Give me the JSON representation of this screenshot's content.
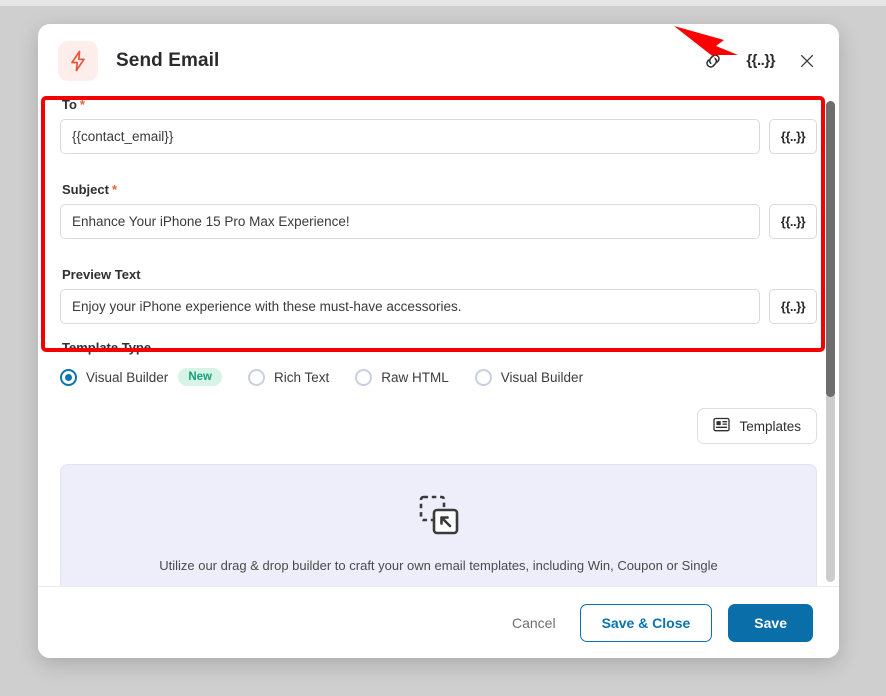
{
  "dialog": {
    "title": "Send Email",
    "icon": "lightning-bolt-icon",
    "header_icons": {
      "link": "link-icon",
      "merge_tag": "{{..}}",
      "close": "close-icon"
    }
  },
  "form": {
    "fields": [
      {
        "label": "To",
        "required": true,
        "required_marker": "*",
        "value": "{{contact_email}}",
        "merge_button_label": "{{..}}"
      },
      {
        "label": "Subject",
        "required": true,
        "required_marker": "*",
        "value": "Enhance Your iPhone 15 Pro Max Experience!",
        "merge_button_label": "{{..}}"
      },
      {
        "label": "Preview Text",
        "required": false,
        "required_marker": "",
        "value": "Enjoy your iPhone experience with these must-have accessories.",
        "merge_button_label": "{{..}}"
      }
    ]
  },
  "template_type": {
    "label": "Template Type",
    "options": [
      {
        "label": "Visual Builder",
        "selected": true,
        "badge": "New"
      },
      {
        "label": "Rich Text",
        "selected": false,
        "badge": ""
      },
      {
        "label": "Raw HTML",
        "selected": false,
        "badge": ""
      },
      {
        "label": "Visual Builder",
        "selected": false,
        "badge": ""
      }
    ]
  },
  "templates_button": {
    "label": "Templates",
    "icon": "templates-icon"
  },
  "builder_placeholder": {
    "icon": "drag-drop-builder-icon",
    "caption": "Utilize our drag & drop builder to craft your own email templates, including Win, Coupon or Single"
  },
  "footer": {
    "cancel_label": "Cancel",
    "save_close_label": "Save & Close",
    "save_label": "Save"
  },
  "colors": {
    "primary": "#0a6ea8",
    "accent_bolt": "#e8543c",
    "badge_bg": "#d8f3e8",
    "badge_text": "#15a07a",
    "annotation_red": "#f50000"
  }
}
